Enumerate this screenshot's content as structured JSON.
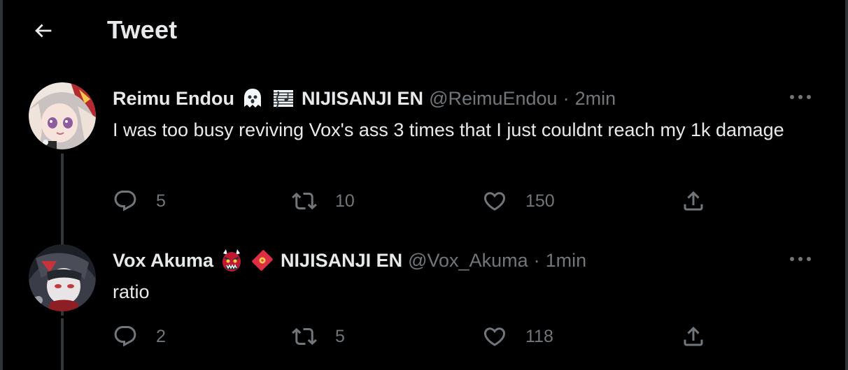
{
  "header": {
    "back_icon": "arrow-left-icon",
    "title": "Tweet"
  },
  "tweets": [
    {
      "display_name": "Reimu Endou",
      "emojis": [
        "ghost-emoji",
        "music-score-emoji"
      ],
      "affiliation": "NIJISANJI EN",
      "handle": "@ReimuEndou",
      "separator": "·",
      "time": "2min",
      "text": "I was too busy reviving Vox's ass 3 times that I just couldnt reach my 1k damage",
      "replies": "5",
      "retweets": "10",
      "likes": "150"
    },
    {
      "display_name": "Vox Akuma",
      "emojis": [
        "ogre-emoji",
        "red-envelope-emoji"
      ],
      "affiliation": "NIJISANJI EN",
      "handle": "@Vox_Akuma",
      "separator": "·",
      "time": "1min",
      "text": "ratio",
      "replies": "2",
      "retweets": "5",
      "likes": "118"
    }
  ],
  "colors": {
    "background": "#000000",
    "text_primary": "#e7e9ea",
    "text_secondary": "#71767b",
    "thread_line": "#333639"
  }
}
